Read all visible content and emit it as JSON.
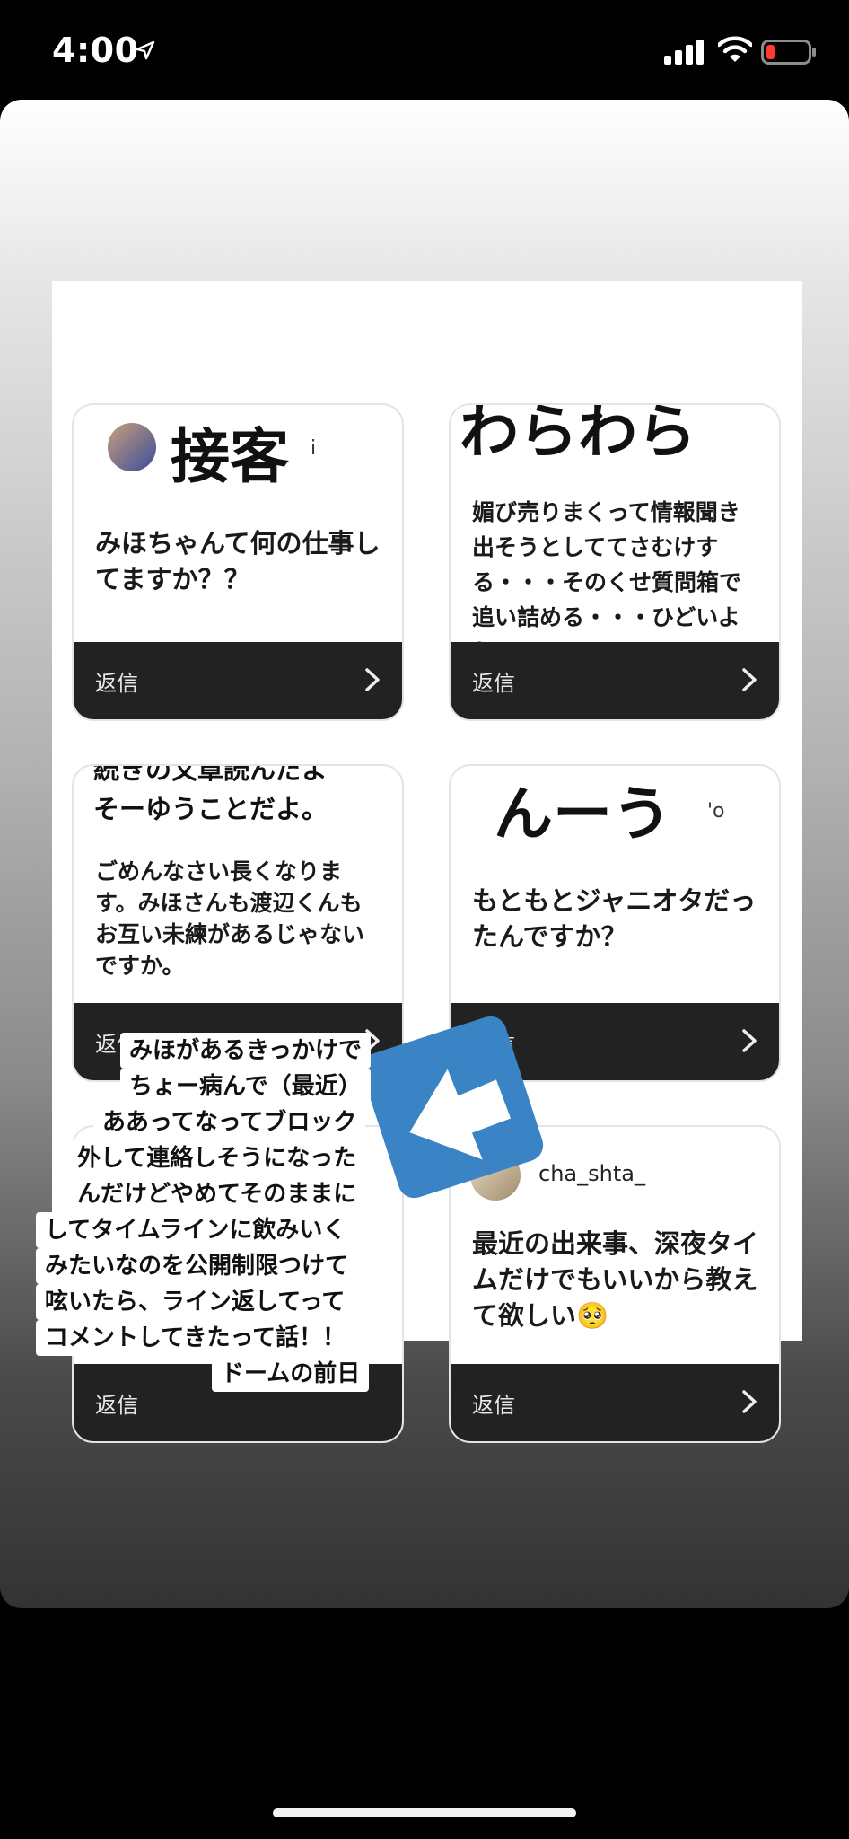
{
  "status_bar": {
    "time": "4:00"
  },
  "cards": [
    {
      "overlay": "接客",
      "username_fragment": "i",
      "question": "みほちゃんて何の仕事してますか？？",
      "reply": "返信"
    },
    {
      "overlay": "わらわら",
      "question": "媚び売りまくって情報聞き出そうとしててさむけする・・・そのくせ質問箱で追い詰める・・・ひどいよね",
      "reply": "返信"
    },
    {
      "overlay_line1": "続きの文章読んだよ",
      "overlay_line2": "そーゆうことだよ。",
      "question": "ごめんなさい長くなります。みほさんも渡辺くんもお互い未練があるじゃないですか。",
      "reply": "返信"
    },
    {
      "overlay": "んーう",
      "username_fragment": "'o",
      "question": "もともとジャニオタだったんですか？",
      "reply": "返信"
    },
    {
      "question": "",
      "reply": "返信"
    },
    {
      "username": "cha_shta_",
      "question": "最近の出来事、深夜タイムだけでもいいから教えて欲しい",
      "reply": "返信",
      "emoji": "🥺"
    }
  ],
  "caption_lines": [
    "みほがあるきっかけで",
    "ちょー病んで（最近）",
    "ああってなってブロック",
    "外して連絡しそうになった",
    "んだけどやめてそのままに",
    "してタイムラインに飲みいく",
    "みたいなのを公開制限つけて",
    "呟いたら、ライン返してって",
    "コメントしてきたって話！！",
    "ドームの前日"
  ],
  "colors": {
    "reply_bar": "#222222",
    "arrow_sticker": "#3a83c4"
  },
  "icons": [
    "location-arrow-icon",
    "signal-icon",
    "wifi-icon",
    "battery-icon",
    "chevron-right-icon",
    "arrow-left-icon"
  ]
}
